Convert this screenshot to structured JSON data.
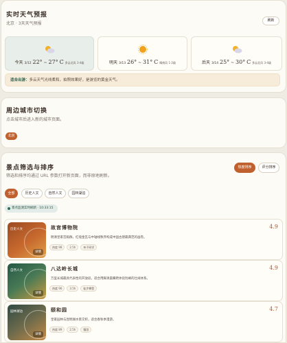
{
  "weather": {
    "title": "实时天气预报",
    "subtitle": "北京 · 3天天气预报",
    "refresh_label": "刷新",
    "days": [
      {
        "day": "今天",
        "date": "3/12",
        "low": "22°",
        "high": "27°",
        "unit": "C",
        "cond": "多云北风 3-4级",
        "icon": "cloudy-sun-icon"
      },
      {
        "day": "明天",
        "date": "3/13",
        "low": "26°",
        "high": "31°",
        "unit": "C",
        "cond": "晴南风 1-2级",
        "icon": "sun-icon"
      },
      {
        "day": "后天",
        "date": "3/14",
        "low": "25°",
        "high": "30°",
        "unit": "C",
        "cond": "多云北风 3-4级",
        "icon": "cloudy-sun-icon"
      }
    ],
    "tip_label": "适合出游：",
    "tip_text": "多云天气光线柔和，拍照效果好，是游览的黄金天气。"
  },
  "city": {
    "title": "周边城市切换",
    "subtitle": "点击城市后进入新的城市页面。",
    "chip": "北京"
  },
  "list": {
    "title": "景点筛选与排序",
    "subtitle": "筛选和排序均通过 URL 参数打开新页面，而非原地刷新。",
    "sort_hot": "热度排序",
    "sort_score": "评分排序",
    "tabs": [
      "全部",
      "历史人文",
      "自然人文",
      "园林湖泊"
    ],
    "timer": "景点监测实时刷新 · 10:33:15",
    "items": [
      {
        "tag": "历史人文",
        "detail": "详情",
        "name": "故宫博物院",
        "score": "4.9",
        "desc": "明清皇家宫殿群，红墙金瓦与中轴线秩序构成中国古建最典范的画卷。",
        "badges": [
          "热度 98",
          "2.5h",
          "亲子研学"
        ]
      },
      {
        "tag": "自然人文",
        "detail": "详情",
        "name": "八达岭长城",
        "score": "4.9",
        "desc": "万里长城最具代表性的开放段，适合用脚清晨攀爬体验险峰的壮阔体系。",
        "badges": [
          "热度 96",
          "3.5h",
          "徒步攀登"
        ]
      },
      {
        "tag": "园林湖泊",
        "detail": "详情",
        "name": "颐和园",
        "score": "4.7",
        "desc": "皇家园林与昆明湖水景交织，适合春秋季漫游。",
        "badges": [
          "热度 89",
          "2.5h",
          "慢游"
        ]
      }
    ]
  },
  "colors": {
    "accent": "#c0602e",
    "thumb_history": "#b45a2a",
    "thumb_nature": "#2f6550",
    "thumb_garden": "#3c4e47"
  }
}
